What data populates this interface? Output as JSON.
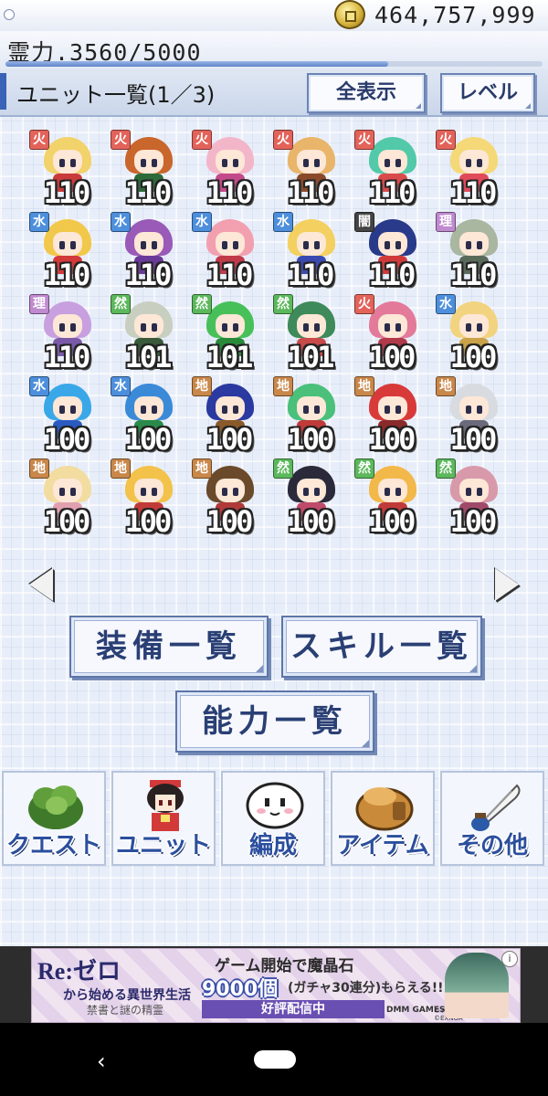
{
  "status": {
    "money": "464,757,999銭",
    "spirit": "霊力.3560/5000",
    "spirit_fraction": 0.712
  },
  "header": {
    "title": "ユニット一覧(1／3)",
    "show_all_label": "全表示",
    "sort_label": "レベル"
  },
  "units": [
    {
      "element": "火",
      "level": "110",
      "hair": "#f2d26a",
      "outfit": "#c93a3a",
      "badge": "#e3635a"
    },
    {
      "element": "火",
      "level": "110",
      "hair": "#c9662c",
      "outfit": "#2d6a3a",
      "badge": "#e3635a"
    },
    {
      "element": "火",
      "level": "110",
      "hair": "#f3b6c9",
      "outfit": "#c34a8a",
      "badge": "#e3635a"
    },
    {
      "element": "火",
      "level": "110",
      "hair": "#e9b56a",
      "outfit": "#8a4a2a",
      "badge": "#e3635a"
    },
    {
      "element": "火",
      "level": "110",
      "hair": "#52c9a8",
      "outfit": "#d94a4a",
      "badge": "#e3635a"
    },
    {
      "element": "火",
      "level": "110",
      "hair": "#f5d878",
      "outfit": "#e04a5a",
      "badge": "#e3635a"
    },
    {
      "element": "水",
      "level": "110",
      "hair": "#f2c84a",
      "outfit": "#d33a3a",
      "badge": "#4d8fdc"
    },
    {
      "element": "水",
      "level": "110",
      "hair": "#9a5ab8",
      "outfit": "#6a3a9a",
      "badge": "#4d8fdc"
    },
    {
      "element": "水",
      "level": "110",
      "hair": "#f2a0b0",
      "outfit": "#c03a4a",
      "badge": "#4d8fdc"
    },
    {
      "element": "水",
      "level": "110",
      "hair": "#f3d060",
      "outfit": "#3a4ab0",
      "badge": "#4d8fdc"
    },
    {
      "element": "闇",
      "level": "110",
      "hair": "#2a3a8a",
      "outfit": "#d03a3a",
      "badge": "#444444"
    },
    {
      "element": "理",
      "level": "110",
      "hair": "#a9b6a0",
      "outfit": "#5a6a5a",
      "badge": "#c08ad0"
    },
    {
      "element": "理",
      "level": "110",
      "hair": "#c8a0e0",
      "outfit": "#7a5aa8",
      "badge": "#c08ad0"
    },
    {
      "element": "然",
      "level": "101",
      "hair": "#c9cfc0",
      "outfit": "#3a5a3a",
      "badge": "#5cb85c"
    },
    {
      "element": "然",
      "level": "101",
      "hair": "#48c05a",
      "outfit": "#2a8a3a",
      "badge": "#5cb85c"
    },
    {
      "element": "然",
      "level": "101",
      "hair": "#3e8a5a",
      "outfit": "#c84a4a",
      "badge": "#5cb85c"
    },
    {
      "element": "火",
      "level": "100",
      "hair": "#e37a9a",
      "outfit": "#b03a4a",
      "badge": "#e3635a"
    },
    {
      "element": "水",
      "level": "100",
      "hair": "#f2d480",
      "outfit": "#c9a24a",
      "badge": "#4d8fdc"
    },
    {
      "element": "水",
      "level": "100",
      "hair": "#3aa8e8",
      "outfit": "#2a5ac0",
      "badge": "#4d8fdc"
    },
    {
      "element": "水",
      "level": "100",
      "hair": "#3a8ad8",
      "outfit": "#2a8a4a",
      "badge": "#4d8fdc"
    },
    {
      "element": "地",
      "level": "100",
      "hair": "#2a3aa0",
      "outfit": "#8a5a2a",
      "badge": "#c9874a"
    },
    {
      "element": "地",
      "level": "100",
      "hair": "#4ac07a",
      "outfit": "#c03a3a",
      "badge": "#c9874a"
    },
    {
      "element": "地",
      "level": "100",
      "hair": "#d83a3a",
      "outfit": "#8a2a2a",
      "badge": "#c9874a"
    },
    {
      "element": "地",
      "level": "100",
      "hair": "#d8dce0",
      "outfit": "#6a6a7a",
      "badge": "#c9874a"
    },
    {
      "element": "地",
      "level": "100",
      "hair": "#f2dca0",
      "outfit": "#e0a0b0",
      "badge": "#c9874a"
    },
    {
      "element": "地",
      "level": "100",
      "hair": "#f2c24a",
      "outfit": "#c03a3a",
      "badge": "#c9874a"
    },
    {
      "element": "地",
      "level": "100",
      "hair": "#6a4a2a",
      "outfit": "#b03a3a",
      "badge": "#c9874a"
    },
    {
      "element": "然",
      "level": "100",
      "hair": "#2a2a3a",
      "outfit": "#c04a6a",
      "badge": "#5cb85c"
    },
    {
      "element": "然",
      "level": "100",
      "hair": "#f2b84a",
      "outfit": "#c03a3a",
      "badge": "#5cb85c"
    },
    {
      "element": "然",
      "level": "100",
      "hair": "#d89aaa",
      "outfit": "#a04a6a",
      "badge": "#5cb85c"
    }
  ],
  "actions": {
    "equipment_list": "装備一覧",
    "skill_list": "スキル一覧",
    "ability_list": "能力一覧"
  },
  "menu": [
    {
      "label": "クエスト",
      "icon": "bush-icon"
    },
    {
      "label": "ユニット",
      "icon": "character-icon"
    },
    {
      "label": "編成",
      "icon": "face-icon"
    },
    {
      "label": "アイテム",
      "icon": "bag-icon"
    },
    {
      "label": "その他",
      "icon": "quill-icon"
    }
  ],
  "ad": {
    "logo": "Re:ゼロ",
    "subtitle": "から始める異世界生活",
    "subtitle2": "禁書と謎の精霊",
    "headline": "ゲーム開始で魔晶石",
    "count": "9000個",
    "rest": "(ガチャ30連分)もらえる!!",
    "ribbon": "好評配信中",
    "brand": "DMM GAMES",
    "copyright": "©TN,KL,Re:ZERO2P ©EXNOA",
    "info": "i"
  },
  "nav": {
    "back": "‹"
  }
}
